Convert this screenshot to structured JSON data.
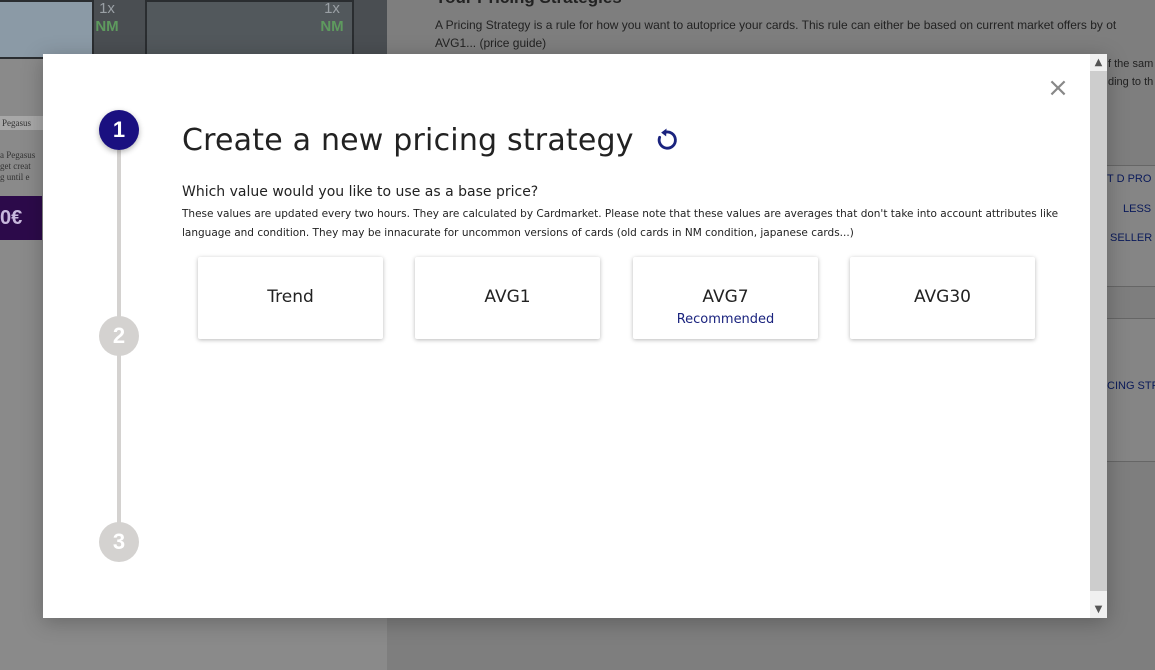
{
  "background": {
    "card_badges": [
      {
        "qty": "1x",
        "condition": "NM"
      },
      {
        "qty": "1x",
        "condition": "NM"
      }
    ],
    "card_name": "Pegasus",
    "card_text_lines": [
      "a Pegasus",
      "get creat",
      "g until e"
    ],
    "price_fragment": "0€",
    "heading_fragment": "Your Pricing Strategies",
    "paragraph_line1": "A Pricing Strategy is a rule for how you want to autoprice your cards. This rule can either be based on current market offers by ot",
    "paragraph_line2": "AVG1... (price guide)",
    "side_fragment_1": "f the sam",
    "side_fragment_2": "ding to th",
    "link_1": "T D PRO",
    "link_2": "LESS",
    "link_3": "SELLER",
    "link_4": "CING STR"
  },
  "modal": {
    "close_label": "×",
    "steps": [
      "1",
      "2",
      "3"
    ],
    "title": "Create a new pricing strategy",
    "question": "Which value would you like to use as a base price?",
    "description": "These values are updated every two hours. They are calculated by Cardmarket. Please note that these values are averages that don't take into account attributes like language and condition. They may be innacurate for uncommon versions of cards (old cards in NM condition, japanese cards...)",
    "options": [
      {
        "label": "Trend",
        "note": ""
      },
      {
        "label": "AVG1",
        "note": ""
      },
      {
        "label": "AVG7",
        "note": "Recommended"
      },
      {
        "label": "AVG30",
        "note": ""
      }
    ],
    "colors": {
      "active_step": "#1a1080",
      "inactive_step": "#d4d2d0",
      "accent": "#1a237e"
    },
    "icons": {
      "refresh": "refresh-icon",
      "close": "close-icon"
    }
  }
}
